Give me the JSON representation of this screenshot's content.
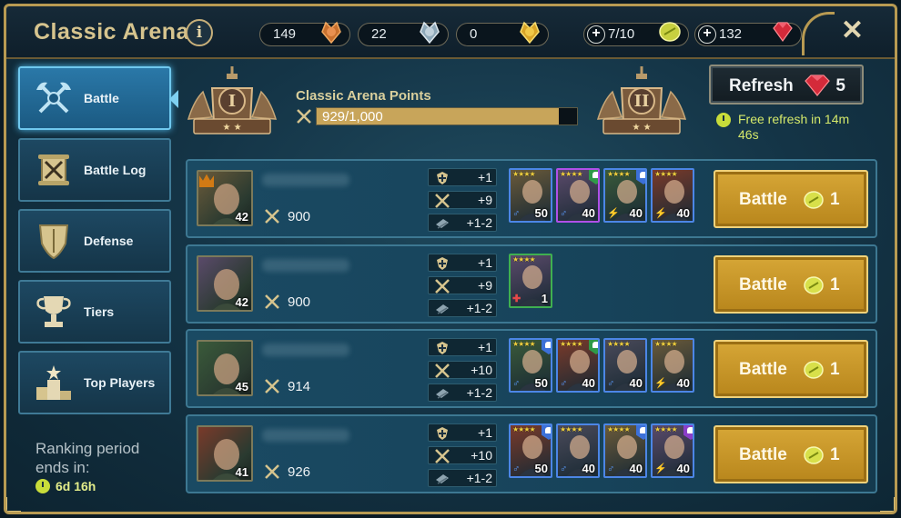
{
  "header": {
    "title": "Classic Arena",
    "info_label": "i",
    "close_label": "✕",
    "currencies": [
      {
        "name": "bronze-medal",
        "value": "149"
      },
      {
        "name": "silver-medal",
        "value": "22"
      },
      {
        "name": "gold-medal",
        "value": "0"
      },
      {
        "name": "arena-token",
        "value": "7/10"
      },
      {
        "name": "gems",
        "value": "132"
      }
    ]
  },
  "sidebar": {
    "items": [
      {
        "label": "Battle",
        "icon": "crossed-axes-icon",
        "active": true
      },
      {
        "label": "Battle Log",
        "icon": "scroll-icon",
        "active": false
      },
      {
        "label": "Defense",
        "icon": "shield-icon",
        "active": false
      },
      {
        "label": "Tiers",
        "icon": "trophy-icon",
        "active": false
      },
      {
        "label": "Top Players",
        "icon": "podium-icon",
        "active": false
      }
    ],
    "ranking_label": "Ranking period ends in:",
    "ranking_time": "6d 16h"
  },
  "points": {
    "label": "Classic Arena Points",
    "value_text": "929/1,000",
    "current": 929,
    "max": 1000,
    "current_tier": "I",
    "next_tier": "II"
  },
  "refresh": {
    "label": "Refresh",
    "cost": "5",
    "free_text": "Free refresh in 14m 46s"
  },
  "opponents": [
    {
      "level": "42",
      "power": "900",
      "leader": true,
      "stats": [
        "+1",
        "+9",
        "+1-2"
      ],
      "champions": [
        {
          "level": "50",
          "rarity": "rare",
          "mark": "",
          "affinity": "magic"
        },
        {
          "level": "40",
          "rarity": "epic",
          "mark": "shield",
          "affinity": "magic"
        },
        {
          "level": "40",
          "rarity": "rare",
          "mark": "heart",
          "affinity": "spirit"
        },
        {
          "level": "40",
          "rarity": "rare",
          "mark": "",
          "affinity": "spirit"
        }
      ],
      "battle_label": "Battle",
      "battle_cost": "1"
    },
    {
      "level": "42",
      "power": "900",
      "leader": false,
      "stats": [
        "+1",
        "+9",
        "+1-2"
      ],
      "champions": [
        {
          "level": "1",
          "rarity": "unc",
          "mark": "",
          "affinity": "force"
        }
      ],
      "battle_label": "Battle",
      "battle_cost": "1"
    },
    {
      "level": "45",
      "power": "914",
      "leader": false,
      "stats": [
        "+1",
        "+10",
        "+1-2"
      ],
      "champions": [
        {
          "level": "50",
          "rarity": "rare",
          "mark": "heart",
          "affinity": "magic"
        },
        {
          "level": "40",
          "rarity": "rare",
          "mark": "shield",
          "affinity": "magic"
        },
        {
          "level": "40",
          "rarity": "rare",
          "mark": "",
          "affinity": "magic"
        },
        {
          "level": "40",
          "rarity": "rare",
          "mark": "",
          "affinity": "spirit"
        }
      ],
      "battle_label": "Battle",
      "battle_cost": "1"
    },
    {
      "level": "41",
      "power": "926",
      "leader": false,
      "stats": [
        "+1",
        "+10",
        "+1-2"
      ],
      "champions": [
        {
          "level": "50",
          "rarity": "rare",
          "mark": "heart",
          "affinity": "magic"
        },
        {
          "level": "40",
          "rarity": "rare",
          "mark": "",
          "affinity": "magic"
        },
        {
          "level": "40",
          "rarity": "rare",
          "mark": "heart",
          "affinity": "magic"
        },
        {
          "level": "40",
          "rarity": "rare",
          "mark": "user",
          "affinity": "spirit"
        }
      ],
      "battle_label": "Battle",
      "battle_cost": "1"
    }
  ],
  "colors": {
    "accent_gold": "#d6a636",
    "panel_blue": "#17435a",
    "active_blue": "#2a78a8",
    "timer_green": "#d4e86a"
  }
}
